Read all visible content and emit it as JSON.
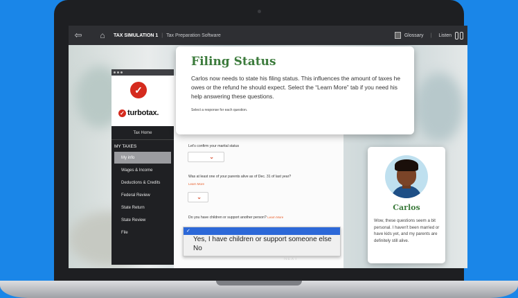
{
  "topbar": {
    "title": "TAX SIMULATION 1",
    "subtitle": "Tax Preparation Software",
    "glossary_label": "Glossary",
    "listen_label": "Listen"
  },
  "turbotax": {
    "logo_text": "turbotax.",
    "home_label": "Tax Home",
    "section_label": "MY TAXES",
    "nav_items": [
      {
        "label": "My info",
        "active": true
      },
      {
        "label": "Wages & Income"
      },
      {
        "label": "Deductions & Credits"
      },
      {
        "label": "Federal Review"
      },
      {
        "label": "State Return"
      },
      {
        "label": "State Review"
      },
      {
        "label": "File"
      }
    ]
  },
  "card": {
    "title": "Filing Status",
    "body": "Carlos now needs to state his filing status. This influences the amount of taxes he owes or the refund he should expect. Select the “Learn More” tab if you need his help answering these questions.",
    "note": "Select a response for each question."
  },
  "questions": {
    "q1": "Let's confirm your marital status",
    "q2": "Was at least one of your parents alive as of Dec. 31 of last year?",
    "q2_learn_more": "Learn More",
    "q3": "Do you have children or support another person?",
    "q3_learn_more": "Learn More"
  },
  "dropdown_options": {
    "selected_mark": "✓",
    "option_1": "Yes, I have children or support someone else",
    "option_2": "No"
  },
  "next_label": "NEXT",
  "character": {
    "name": "Carlos",
    "speech": "Wow, these questions seem a bit personal. I haven't been married or have kids yet, and my parents are definitely still alive."
  },
  "colors": {
    "background": "#1a86e8",
    "accent_green": "#3c7b3c",
    "turbotax_red": "#d52b1e",
    "dropdown_highlight": "#2c68d8"
  }
}
